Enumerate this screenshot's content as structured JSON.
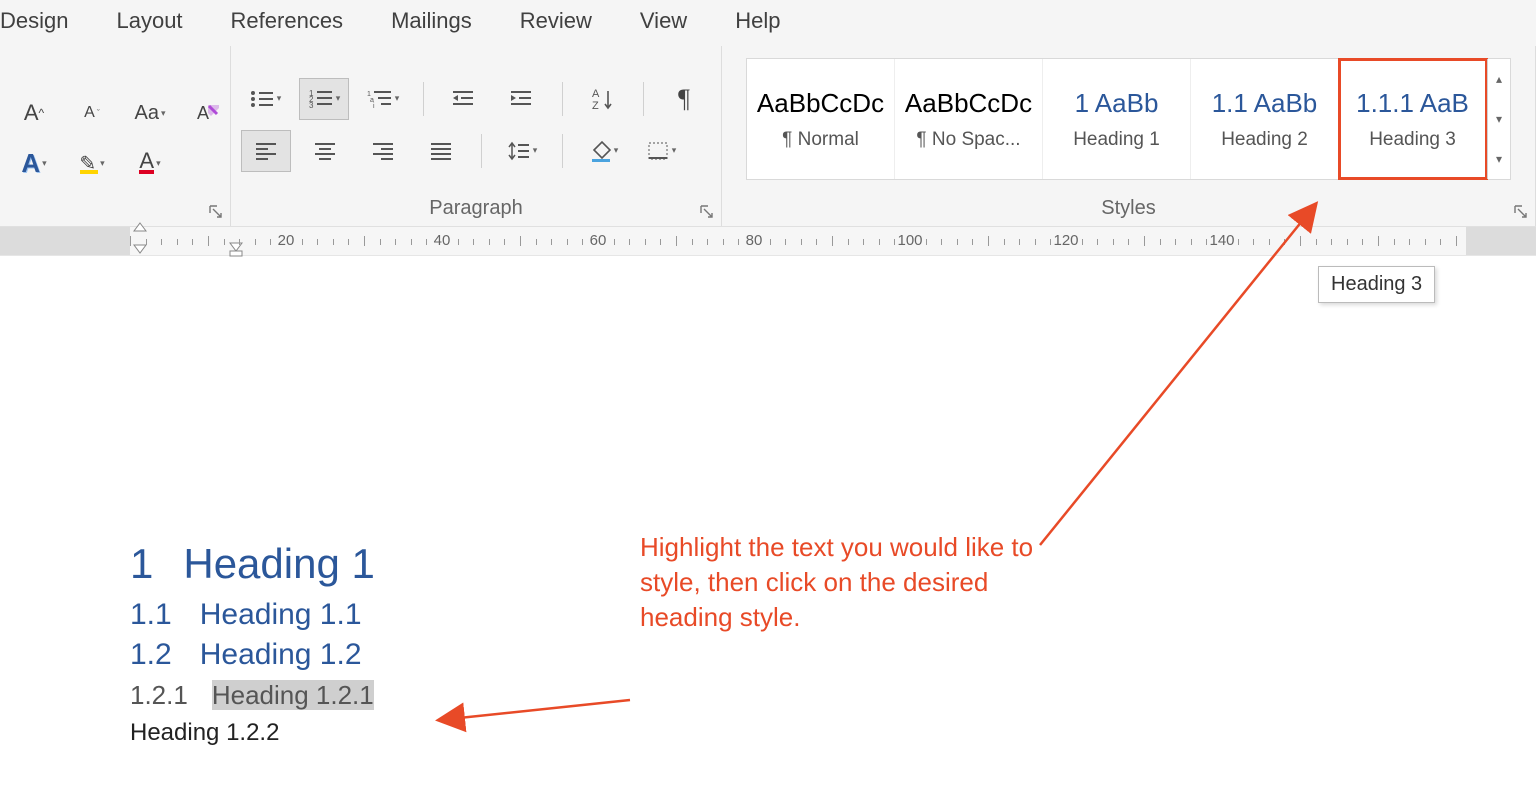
{
  "tabs": [
    "Design",
    "Layout",
    "References",
    "Mailings",
    "Review",
    "View",
    "Help"
  ],
  "groupLabels": {
    "paragraph": "Paragraph",
    "styles": "Styles"
  },
  "styles": [
    {
      "preview": "AaBbCcDc",
      "name": "¶ Normal",
      "blue": false
    },
    {
      "preview": "AaBbCcDc",
      "name": "¶ No Spac...",
      "blue": false
    },
    {
      "preview": "1  AaBb",
      "name": "Heading 1",
      "blue": true
    },
    {
      "preview": "1.1  AaBb",
      "name": "Heading 2",
      "blue": true
    },
    {
      "preview": "1.1.1  AaB",
      "name": "Heading 3",
      "blue": true
    }
  ],
  "tooltip": "Heading 3",
  "rulerTicks": [
    20,
    40,
    60,
    80,
    100,
    120,
    140
  ],
  "doc": {
    "h1": {
      "num": "1",
      "text": "Heading 1"
    },
    "h2a": {
      "num": "1.1",
      "text": "Heading 1.1"
    },
    "h2b": {
      "num": "1.2",
      "text": "Heading 1.2"
    },
    "h3": {
      "num": "1.2.1",
      "text": "Heading 1.2.1"
    },
    "body": "Heading 1.2.2"
  },
  "annotation": "Highlight the text you would like to style, then click on the desired heading style."
}
